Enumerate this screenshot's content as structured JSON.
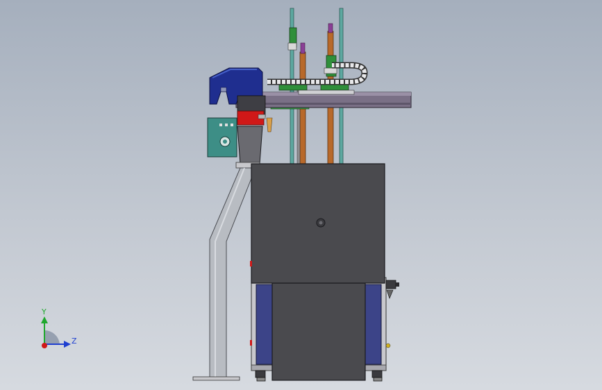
{
  "viewport": {
    "background_top": "#a5afbd",
    "background_bottom": "#d6dae0"
  },
  "model": {
    "part_names": [
      "cabinet",
      "base-frame",
      "left-door-window",
      "right-door-window",
      "bent-support-column",
      "support-foot",
      "hopper",
      "control-box",
      "blue-gripper-head",
      "red-actuator-block",
      "horizontal-beam",
      "cable-chain",
      "vertical-guide-rods",
      "leveling-feet",
      "side-valve"
    ],
    "colors": {
      "cabinet": "#4a4a4e",
      "frame": "#c8c8cc",
      "door_window": "#3c4488",
      "column": "#b8bcc2",
      "gripper": "#1f2e8f",
      "actuator": "#d01818",
      "control_box": "#3d8e86",
      "beam": "#7a7086",
      "green_part": "#2f8f3a",
      "copper_rod": "#b8692a",
      "purple_tip": "#8a3f96",
      "teal_rod": "#5da8a0"
    }
  },
  "triad": {
    "y_label": "Y",
    "z_label": "Z",
    "y_color": "#1fa82d",
    "z_color": "#1f3fd0",
    "x_color": "#d01818"
  }
}
